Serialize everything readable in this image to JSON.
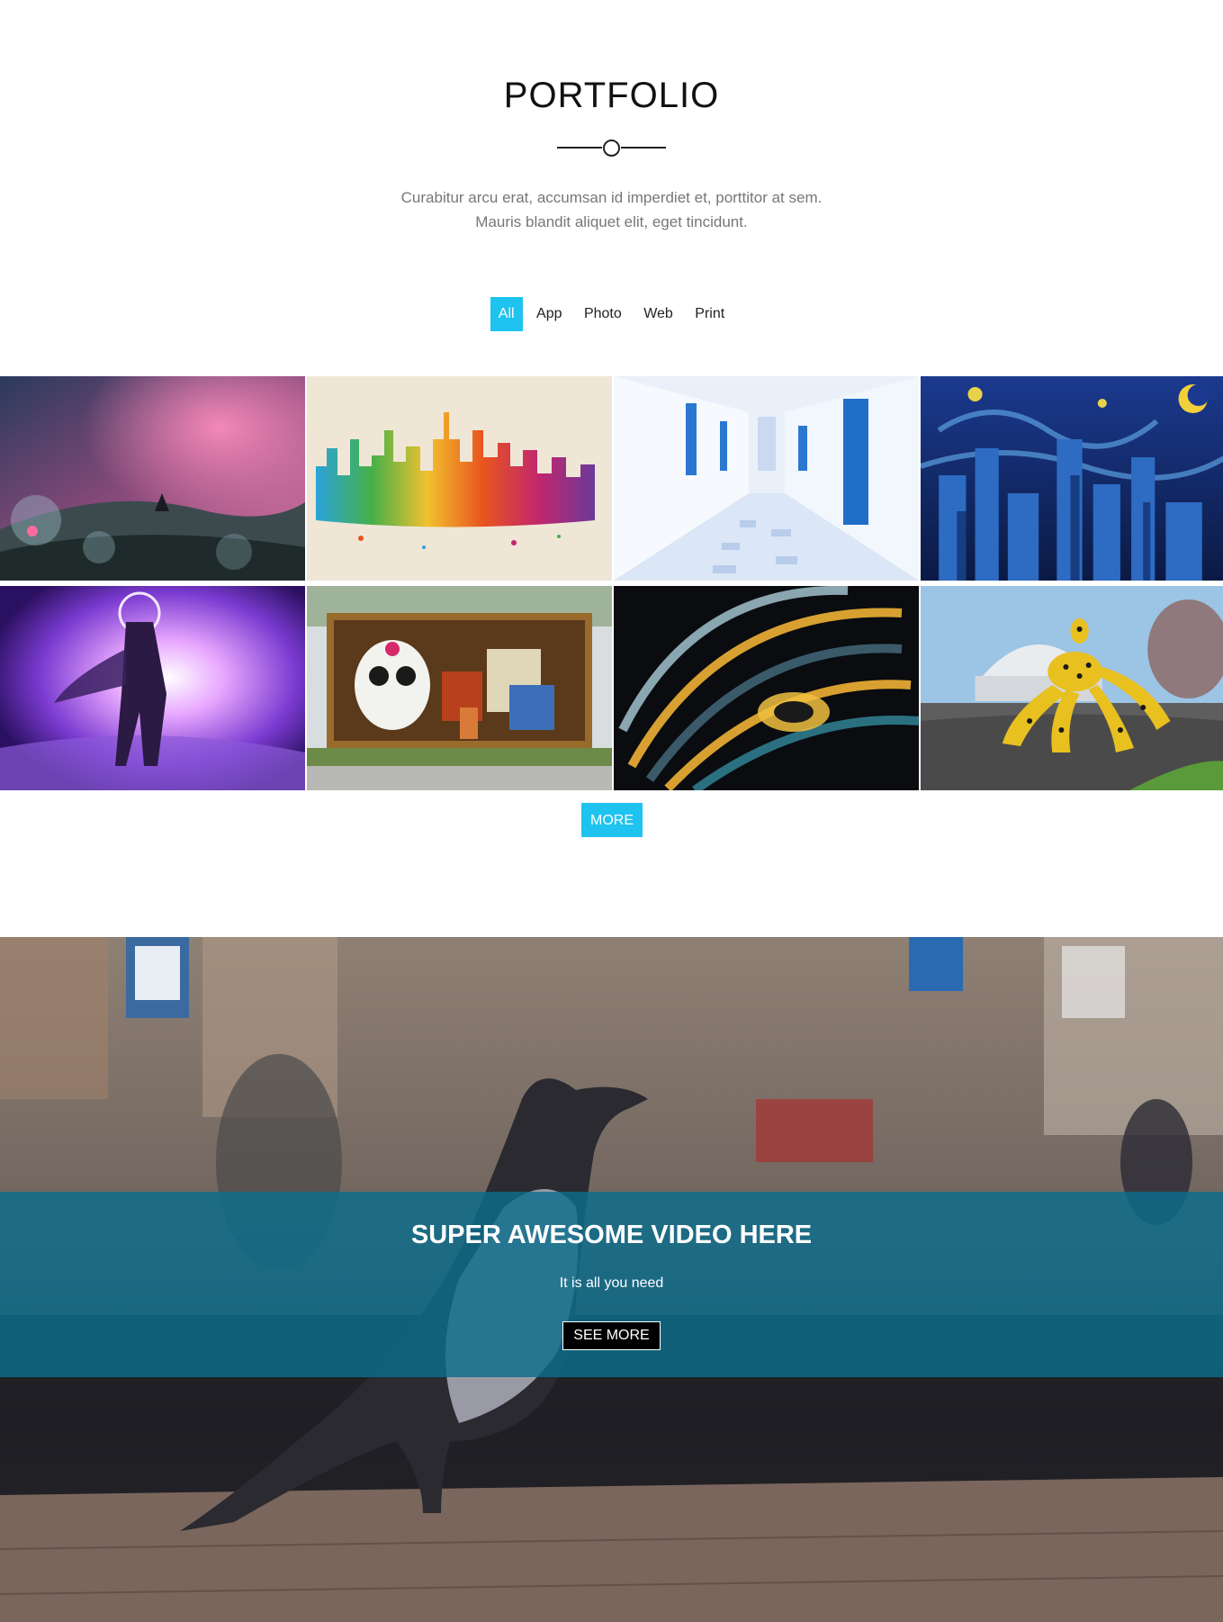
{
  "portfolio": {
    "title": "PORTFOLIO",
    "intro_line1": "Curabitur arcu erat, accumsan id imperdiet et, porttitor at sem.",
    "intro_line2": "Mauris blandit aliquet elit, eget tincidunt.",
    "filters": [
      {
        "label": "All",
        "active": true
      },
      {
        "label": "App",
        "active": false
      },
      {
        "label": "Photo",
        "active": false
      },
      {
        "label": "Web",
        "active": false
      },
      {
        "label": "Print",
        "active": false
      }
    ],
    "tiles": [
      {
        "subject": "fantasy-night-landscape"
      },
      {
        "subject": "watercolor-city-skyline"
      },
      {
        "subject": "whitewashed-alley"
      },
      {
        "subject": "starry-night-city"
      },
      {
        "subject": "glowing-astronaut"
      },
      {
        "subject": "sugar-skull-container"
      },
      {
        "subject": "spiral-architecture"
      },
      {
        "subject": "polka-dot-sculpture"
      }
    ],
    "more_label": "MORE"
  },
  "video": {
    "title": "SUPER AWESOME VIDEO HERE",
    "subtitle": "It is all you need",
    "button_label": "SEE MORE"
  },
  "colors": {
    "accent": "#1ec3f0",
    "band": "#0c6e8c"
  }
}
